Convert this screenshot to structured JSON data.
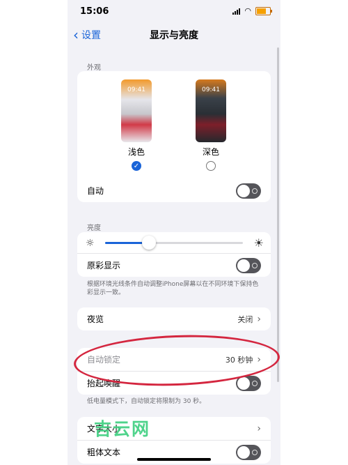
{
  "status": {
    "time": "15:06"
  },
  "nav": {
    "back": "设置",
    "title": "显示与亮度"
  },
  "appearance": {
    "header": "外观",
    "light": {
      "label": "浅色",
      "time": "09:41"
    },
    "dark": {
      "label": "深色",
      "time": "09:41"
    },
    "auto": "自动"
  },
  "brightness": {
    "header": "亮度",
    "value": 0.32,
    "true_tone": "原彩显示",
    "note": "根据环境光线条件自动调整iPhone屏幕以在不同环境下保持色彩显示一致。"
  },
  "night_shift": {
    "label": "夜览",
    "value": "关闭"
  },
  "lock": {
    "auto_lock": "自动锁定",
    "auto_lock_value": "30 秒钟",
    "raise_to_wake": "抬起唤醒",
    "note": "低电量模式下，自动锁定将限制为 30 秒。"
  },
  "text": {
    "size": "文字大小",
    "bold": "粗体文本"
  },
  "watermark": "吉云网",
  "colors": {
    "accent": "#1a64d8",
    "annotation": "#d4263f"
  }
}
